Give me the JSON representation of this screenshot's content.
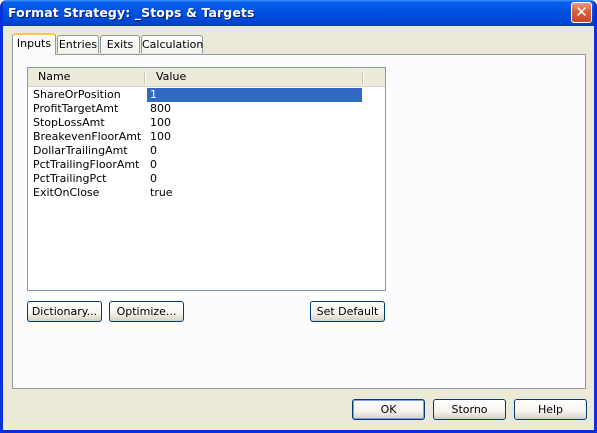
{
  "window": {
    "title": "Format Strategy: _Stops & Targets"
  },
  "titlebar": {
    "close_glyph": "✕"
  },
  "tabs": [
    {
      "label": "Inputs",
      "active": true
    },
    {
      "label": "Entries",
      "active": false
    },
    {
      "label": "Exits",
      "active": false
    },
    {
      "label": "Calculation",
      "active": false
    }
  ],
  "grid": {
    "columns": [
      "Name",
      "Value"
    ],
    "rows": [
      {
        "name": "ShareOrPosition",
        "value": "1",
        "selected": true
      },
      {
        "name": "ProfitTargetAmt",
        "value": "800"
      },
      {
        "name": "StopLossAmt",
        "value": "100"
      },
      {
        "name": "BreakevenFloorAmt",
        "value": "100"
      },
      {
        "name": "DollarTrailingAmt",
        "value": "0"
      },
      {
        "name": "PctTrailingFloorAmt",
        "value": "0"
      },
      {
        "name": "PctTrailingPct",
        "value": "0"
      },
      {
        "name": "ExitOnClose",
        "value": "true"
      }
    ]
  },
  "panel_buttons": {
    "dictionary": "Dictionary...",
    "optimize": "Optimize...",
    "set_default": "Set Default"
  },
  "dialog_buttons": {
    "ok": "OK",
    "cancel": "Storno",
    "help": "Help"
  },
  "colors": {
    "title_bar": "#0054e3",
    "selection": "#316ac5",
    "tab_highlight": "#ffc83c",
    "face": "#ece9d8"
  }
}
